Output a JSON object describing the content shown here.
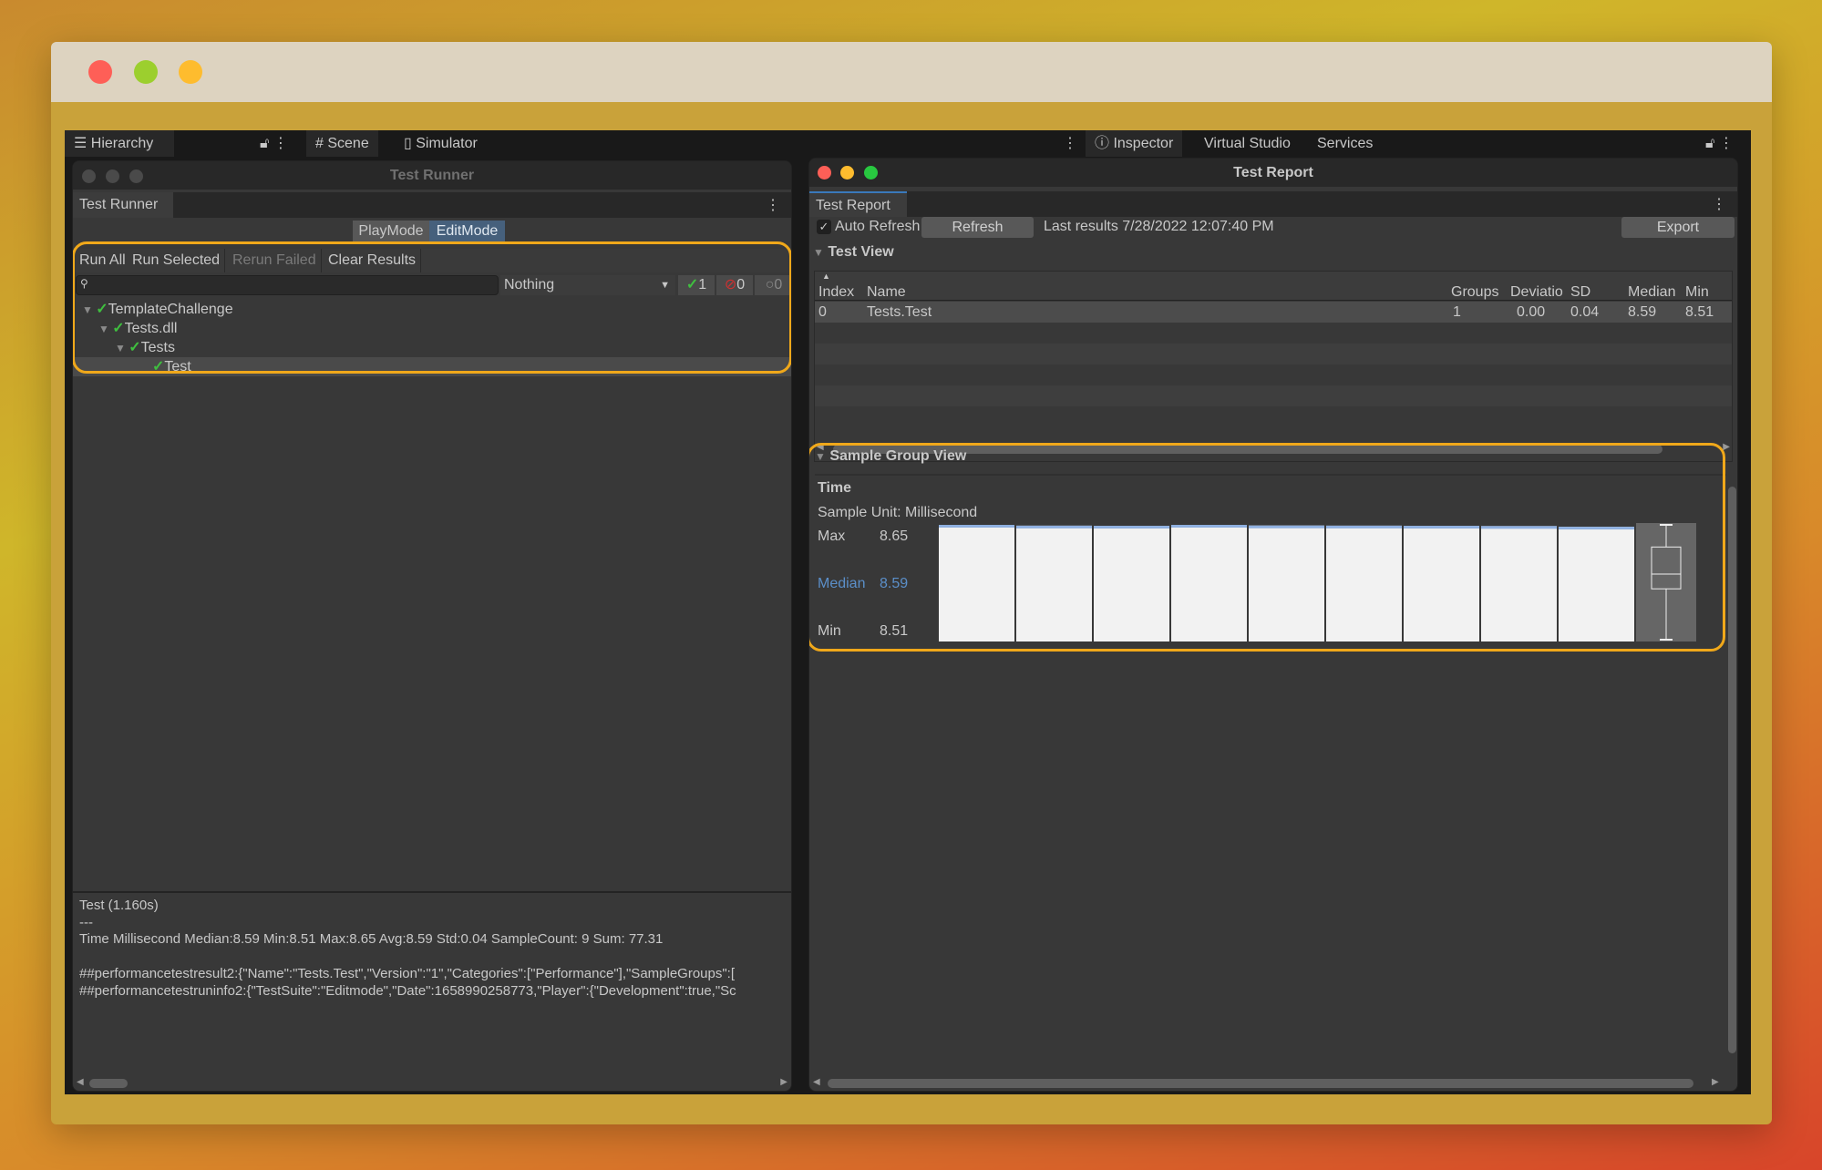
{
  "window": {
    "lights": [
      "#fe5f57",
      "#9ccf2e",
      "#febc2e"
    ]
  },
  "top_tabs": {
    "hierarchy": "Hierarchy",
    "scene": "Scene",
    "simulator": "Simulator",
    "inspector": "Inspector",
    "virtual_studio": "Virtual Studio",
    "services": "Services"
  },
  "test_runner": {
    "title": "Test Runner",
    "tab": "Test Runner",
    "modes": {
      "play": "PlayMode",
      "edit": "EditMode",
      "selected": "EditMode"
    },
    "toolbar": {
      "run_all": "Run All",
      "run_selected": "Run Selected",
      "rerun_failed": "Rerun Failed",
      "clear_results": "Clear Results"
    },
    "search": {
      "value": "",
      "placeholder": ""
    },
    "filter": {
      "value": "Nothing"
    },
    "counters": {
      "passed": "1",
      "failed": "0",
      "skipped": "0"
    },
    "tree": [
      {
        "label": "TemplateChallenge",
        "level": 0,
        "expanded": true,
        "status": "passed"
      },
      {
        "label": "Tests.dll",
        "level": 1,
        "expanded": true,
        "status": "passed"
      },
      {
        "label": "Tests",
        "level": 2,
        "expanded": true,
        "status": "passed"
      },
      {
        "label": "Test",
        "level": 3,
        "status": "passed",
        "selected": true
      }
    ],
    "details": {
      "line1": "Test (1.160s)",
      "line2": "---",
      "line3": "Time Millisecond Median:8.59 Min:8.51 Max:8.65 Avg:8.59 Std:0.04 SampleCount: 9 Sum: 77.31",
      "line4": "##performancetestresult2:{\"Name\":\"Tests.Test\",\"Version\":\"1\",\"Categories\":[\"Performance\"],\"SampleGroups\":[",
      "line5": "##performancetestruninfo2:{\"TestSuite\":\"Editmode\",\"Date\":1658990258773,\"Player\":{\"Development\":true,\"Sc"
    }
  },
  "test_report": {
    "title": "Test Report",
    "tab": "Test Report",
    "auto_refresh_label": "Auto Refresh",
    "auto_refresh": true,
    "refresh": "Refresh",
    "last_results": "Last results 7/28/2022 12:07:40 PM",
    "export": "Export",
    "test_view": "Test View",
    "columns": [
      "Index",
      "Name",
      "Groups",
      "Deviatio",
      "SD",
      "Median",
      "Min"
    ],
    "rows": [
      [
        "0",
        "Tests.Test",
        "1",
        "0.00",
        "0.04",
        "8.59",
        "8.51"
      ]
    ],
    "sample_group_view": "Sample Group View",
    "sample_group": {
      "name": "Time",
      "unit": "Sample Unit: Millisecond",
      "max_label": "Max",
      "max": "8.65",
      "median_label": "Median",
      "median": "8.59",
      "min_label": "Min",
      "min": "8.51",
      "samples": [
        8.65,
        8.59,
        8.58,
        8.65,
        8.6,
        8.59,
        8.58,
        8.56,
        8.51
      ],
      "quartiles": [
        8.572,
        8.623
      ],
      "bar_color": "#f2f2f2",
      "bar_top_color": "#8fb0e0",
      "median_color": "#5b8fc9"
    }
  }
}
